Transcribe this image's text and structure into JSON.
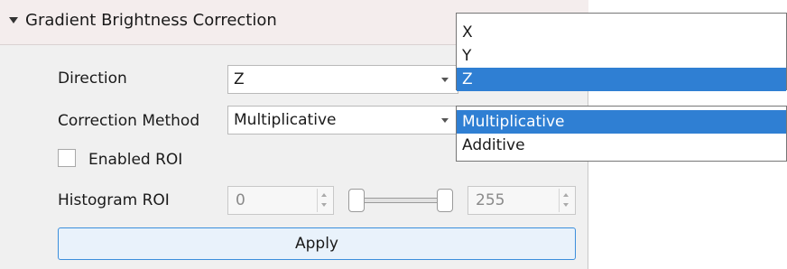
{
  "section": {
    "title": "Gradient Brightness Correction"
  },
  "direction": {
    "label": "Direction",
    "value": "Z",
    "options": [
      "X",
      "Y",
      "Z"
    ],
    "highlighted": "Z"
  },
  "correction_method": {
    "label": "Correction Method",
    "value": "Multiplicative",
    "options": [
      "Multiplicative",
      "Additive"
    ],
    "highlighted": "Multiplicative"
  },
  "enabled_roi": {
    "label": "Enabled ROI",
    "checked": false
  },
  "histogram_roi": {
    "label": "Histogram ROI",
    "min_value": "0",
    "max_value": "255"
  },
  "apply_button": {
    "label": "Apply"
  },
  "colors": {
    "selection": "#2f7fd3",
    "button_border": "#3c8fdc",
    "header_bg": "#f4eded",
    "panel_bg": "#f0f0f0"
  }
}
